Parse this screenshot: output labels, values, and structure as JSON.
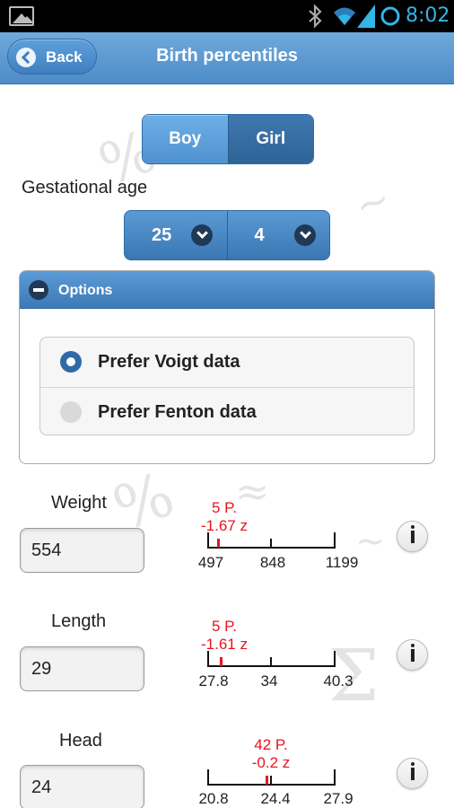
{
  "status_bar": {
    "time": "8:02"
  },
  "header": {
    "back_label": "Back",
    "title": "Birth percentiles"
  },
  "gender_toggle": {
    "boy": "Boy",
    "girl": "Girl",
    "selected": "Boy"
  },
  "gestational_age": {
    "label": "Gestational age",
    "weeks": "25",
    "days": "4"
  },
  "options": {
    "title": "Options",
    "items": [
      {
        "label": "Prefer Voigt data",
        "selected": true
      },
      {
        "label": "Prefer Fenton data",
        "selected": false
      }
    ]
  },
  "measurements": [
    {
      "label": "Weight",
      "value": "554",
      "percentile": "5 P.",
      "z": "-1.67 z",
      "ticks": [
        "497",
        "848",
        "1199"
      ],
      "position": 0.08
    },
    {
      "label": "Length",
      "value": "29",
      "percentile": "5 P.",
      "z": "-1.61 z",
      "ticks": [
        "27.8",
        "34",
        "40.3"
      ],
      "position": 0.1
    },
    {
      "label": "Head",
      "value": "24",
      "percentile": "42 P.",
      "z": "-0.2 z",
      "ticks": [
        "20.8",
        "24.4",
        "27.9"
      ],
      "position": 0.46
    }
  ],
  "colors": {
    "accent": "#4d8cc8",
    "percentile_text": "#e8141c",
    "time": "#33b5e5"
  }
}
